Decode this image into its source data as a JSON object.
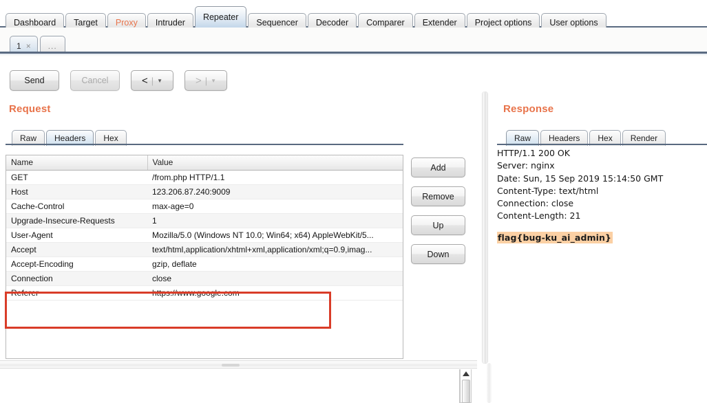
{
  "app": {
    "main_tabs": [
      {
        "label": "Dashboard",
        "state": "normal"
      },
      {
        "label": "Target",
        "state": "normal"
      },
      {
        "label": "Proxy",
        "state": "proxy"
      },
      {
        "label": "Intruder",
        "state": "normal"
      },
      {
        "label": "Repeater",
        "state": "active"
      },
      {
        "label": "Sequencer",
        "state": "normal"
      },
      {
        "label": "Decoder",
        "state": "normal"
      },
      {
        "label": "Comparer",
        "state": "normal"
      },
      {
        "label": "Extender",
        "state": "normal"
      },
      {
        "label": "Project options",
        "state": "normal"
      },
      {
        "label": "User options",
        "state": "normal"
      }
    ],
    "repeater_tabs": [
      {
        "label": "1",
        "close": "×",
        "state": "active"
      },
      {
        "label": "...",
        "state": "dots"
      }
    ]
  },
  "toolbar": {
    "send_label": "Send",
    "cancel_label": "Cancel",
    "back_label": "<",
    "forward_label": ">",
    "separator": "|",
    "caret": "▼"
  },
  "request": {
    "title": "Request",
    "tabs": [
      {
        "label": "Raw",
        "state": "normal"
      },
      {
        "label": "Headers",
        "state": "active"
      },
      {
        "label": "Hex",
        "state": "normal"
      }
    ],
    "table": {
      "columns": [
        "Name",
        "Value"
      ],
      "rows": [
        {
          "name": "GET",
          "value": "/from.php HTTP/1.1"
        },
        {
          "name": "Host",
          "value": "123.206.87.240:9009"
        },
        {
          "name": "Cache-Control",
          "value": "max-age=0"
        },
        {
          "name": "Upgrade-Insecure-Requests",
          "value": "1"
        },
        {
          "name": "User-Agent",
          "value": "Mozilla/5.0 (Windows NT 10.0; Win64; x64) AppleWebKit/5..."
        },
        {
          "name": "Accept",
          "value": "text/html,application/xhtml+xml,application/xml;q=0.9,imag..."
        },
        {
          "name": "Accept-Encoding",
          "value": "gzip, deflate"
        },
        {
          "name": "Connection",
          "value": "close"
        },
        {
          "name": "Referer",
          "value": "https://www.google.com"
        }
      ]
    },
    "side_buttons": [
      "Add",
      "Remove",
      "Up",
      "Down"
    ],
    "highlight_color": "#d93c28"
  },
  "response": {
    "title": "Response",
    "tabs": [
      {
        "label": "Raw",
        "state": "active"
      },
      {
        "label": "Headers",
        "state": "normal"
      },
      {
        "label": "Hex",
        "state": "normal"
      },
      {
        "label": "Render",
        "state": "normal"
      }
    ],
    "body_lines": [
      "HTTP/1.1 200 OK",
      "Server: nginx",
      "Date: Sun, 15 Sep 2019 15:14:50 GMT",
      "Content-Type: text/html",
      "Connection: close",
      "Content-Length: 21"
    ],
    "flag": "flag{bug-ku_ai_admin}",
    "flag_highlight_color": "#fbd0a4"
  },
  "colors": {
    "accent": "#e8734a",
    "tab_active": "#c3d7ea",
    "rule": "#58697f"
  }
}
